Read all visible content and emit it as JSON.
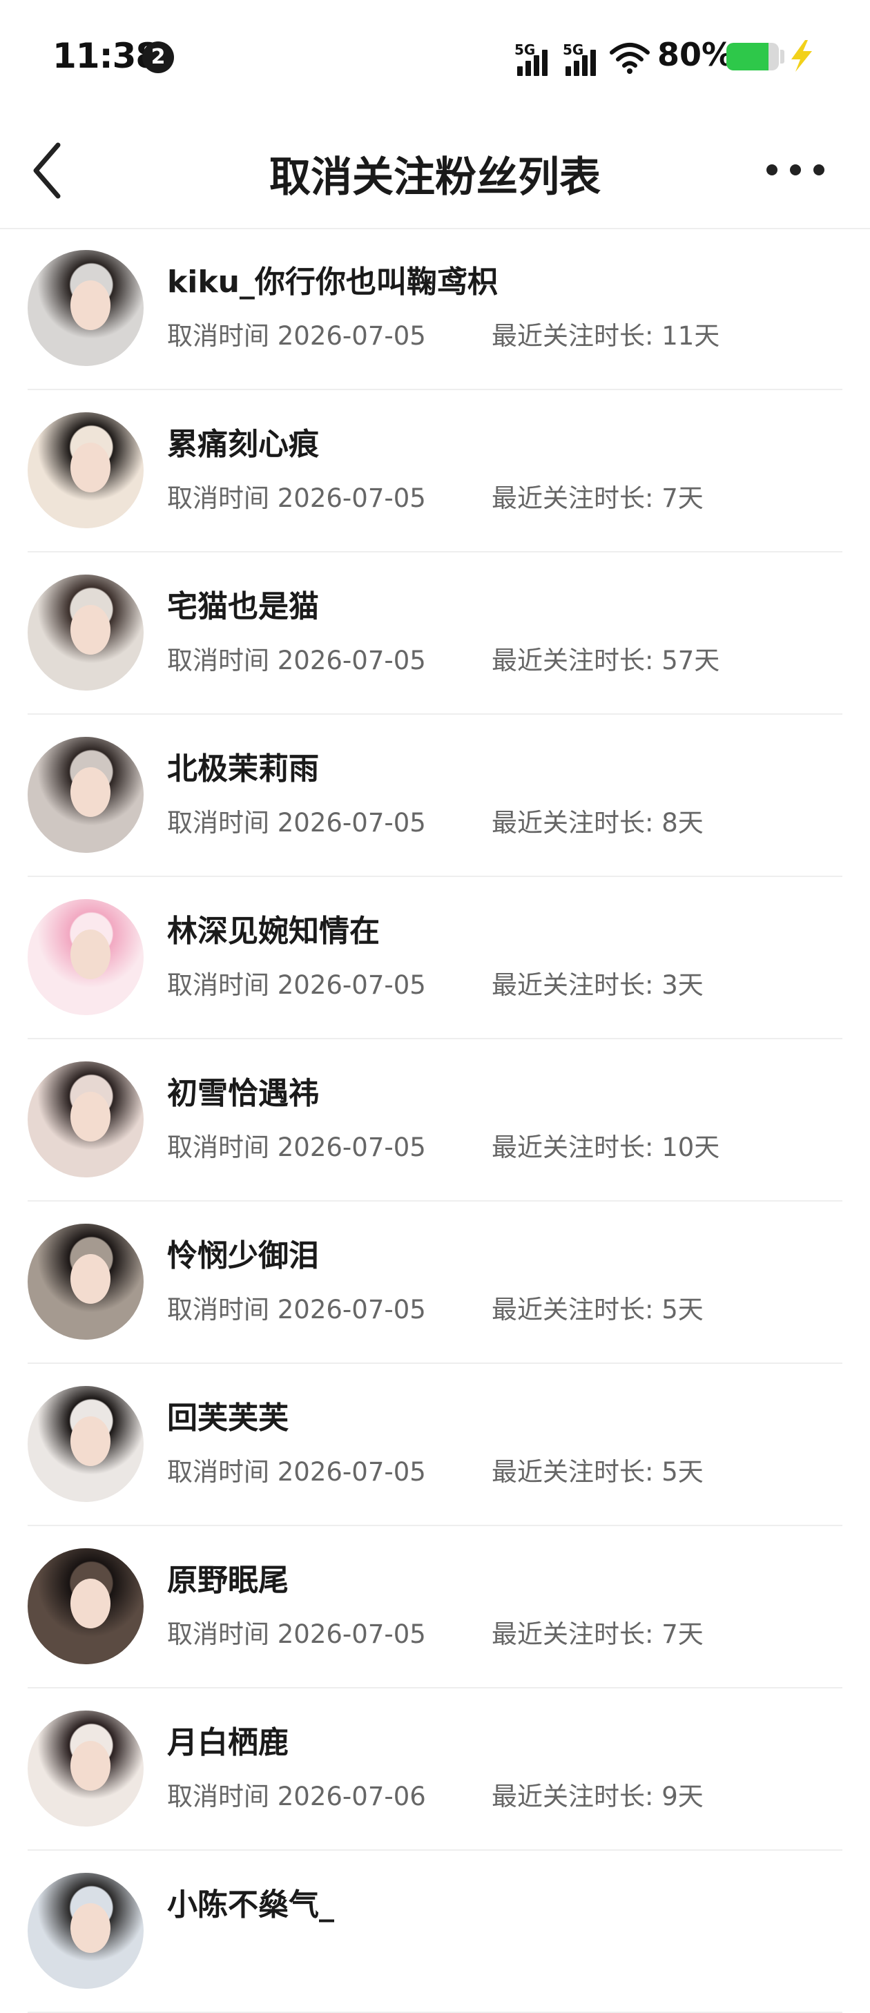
{
  "status_bar": {
    "time": "11:38",
    "notification_count": "2",
    "signal_1_label": "5G",
    "signal_2_label": "5G",
    "battery_percent": "80%",
    "battery_level": 0.8,
    "battery_color": "#2ec84a",
    "charge_color": "#f2d11a"
  },
  "nav": {
    "back_icon": "chevron-left-icon",
    "title": "取消关注粉丝列表",
    "more_icon": "more-horizontal-icon"
  },
  "list": {
    "items": [
      {
        "name": "kiku_你行你也叫鞠鸢枳",
        "cancel_text": "取消时间 2026-07-05",
        "duration_text": "最近关注时长: 11天",
        "avatar_colors": [
          "#d8d6d4",
          "#2a2422"
        ]
      },
      {
        "name": "累痛刻心痕",
        "cancel_text": "取消时间 2026-07-05",
        "duration_text": "最近关注时长: 7天",
        "avatar_colors": [
          "#efe4d8",
          "#1f1b19"
        ]
      },
      {
        "name": "宅猫也是猫",
        "cancel_text": "取消时间 2026-07-05",
        "duration_text": "最近关注时长: 57天",
        "avatar_colors": [
          "#e2dcd6",
          "#3b2f2b"
        ]
      },
      {
        "name": "北极茉莉雨",
        "cancel_text": "取消时间 2026-07-05",
        "duration_text": "最近关注时长: 8天",
        "avatar_colors": [
          "#cfc7c2",
          "#2e2624"
        ]
      },
      {
        "name": "林深见婉知情在",
        "cancel_text": "取消时间 2026-07-05",
        "duration_text": "最近关注时长: 3天",
        "avatar_colors": [
          "#fbe9ee",
          "#f2a9c2"
        ]
      },
      {
        "name": "初雪恰遇祎",
        "cancel_text": "取消时间 2026-07-05",
        "duration_text": "最近关注时长: 10天",
        "avatar_colors": [
          "#e7d8d2",
          "#2b2221"
        ]
      },
      {
        "name": "怜悯少御泪",
        "cancel_text": "取消时间 2026-07-05",
        "duration_text": "最近关注时长: 5天",
        "avatar_colors": [
          "#a59a90",
          "#1c1716"
        ]
      },
      {
        "name": "回芙芙芙",
        "cancel_text": "取消时间 2026-07-05",
        "duration_text": "最近关注时长: 5天",
        "avatar_colors": [
          "#ebe7e4",
          "#1b1716"
        ]
      },
      {
        "name": "原野眠尾",
        "cancel_text": "取消时间 2026-07-05",
        "duration_text": "最近关注时长: 7天",
        "avatar_colors": [
          "#5b4b42",
          "#181312"
        ]
      },
      {
        "name": "月白栖鹿",
        "cancel_text": "取消时间 2026-07-06",
        "duration_text": "最近关注时长: 9天",
        "avatar_colors": [
          "#efe8e3",
          "#2a2020"
        ]
      },
      {
        "name": "小陈不燊气_",
        "cancel_text": "",
        "duration_text": "",
        "avatar_colors": [
          "#d9dfe6",
          "#2b2a2a"
        ]
      }
    ]
  }
}
